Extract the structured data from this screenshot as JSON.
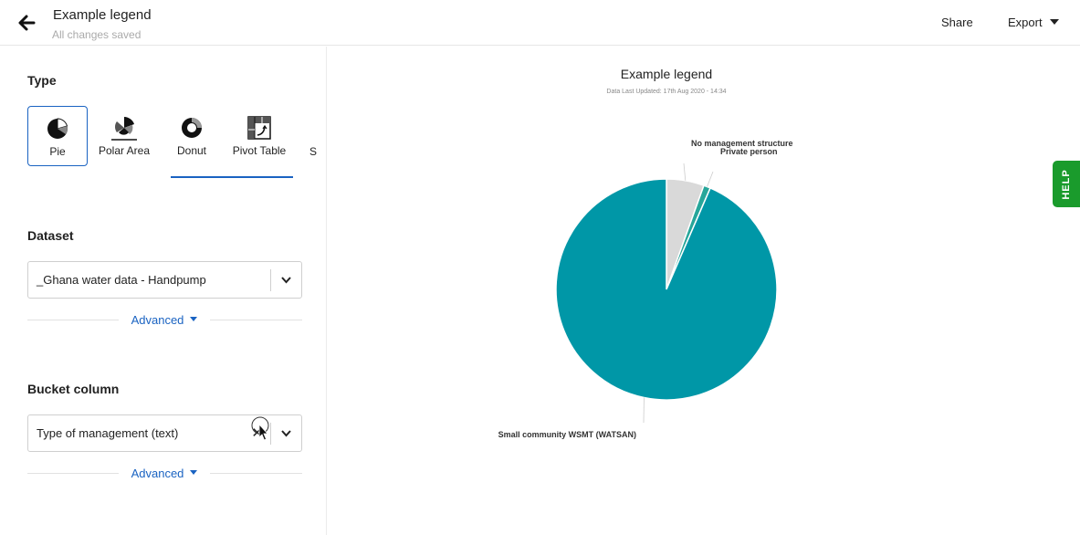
{
  "header": {
    "title": "Example legend",
    "status": "All changes saved",
    "share_label": "Share",
    "export_label": "Export"
  },
  "sidebar": {
    "type_section": {
      "label": "Type",
      "options": [
        {
          "label": "Pie",
          "icon": "pie-icon",
          "selected": true
        },
        {
          "label": "Polar Area",
          "icon": "polar-area-icon"
        },
        {
          "label": "Donut",
          "icon": "donut-icon"
        },
        {
          "label": "Pivot Table",
          "icon": "pivot-table-icon"
        }
      ],
      "overflow_label": "S"
    },
    "dataset": {
      "label": "Dataset",
      "value": "_Ghana water data - Handpump",
      "advanced_label": "Advanced"
    },
    "bucket_column": {
      "label": "Bucket column",
      "value": "Type of management (text)",
      "advanced_label": "Advanced"
    }
  },
  "help_label": "HELP",
  "colors": {
    "accent": "#1a63c2",
    "help": "#1a9b2c",
    "slice_main": "#0097a7",
    "slice_light": "#d9d9d9",
    "slice_teal": "#26a69a"
  },
  "chart_data": {
    "type": "pie",
    "title": "Example legend",
    "subtitle": "Data Last Updated: 17th Aug 2020 - 14:34",
    "series": [
      {
        "name": "No management structure",
        "value": 5.5,
        "color": "#d9d9d9"
      },
      {
        "name": "Private person",
        "value": 1.0,
        "color": "#26a69a"
      },
      {
        "name": "Small community WSMT (WATSAN)",
        "value": 93.5,
        "color": "#0097a7"
      }
    ]
  }
}
